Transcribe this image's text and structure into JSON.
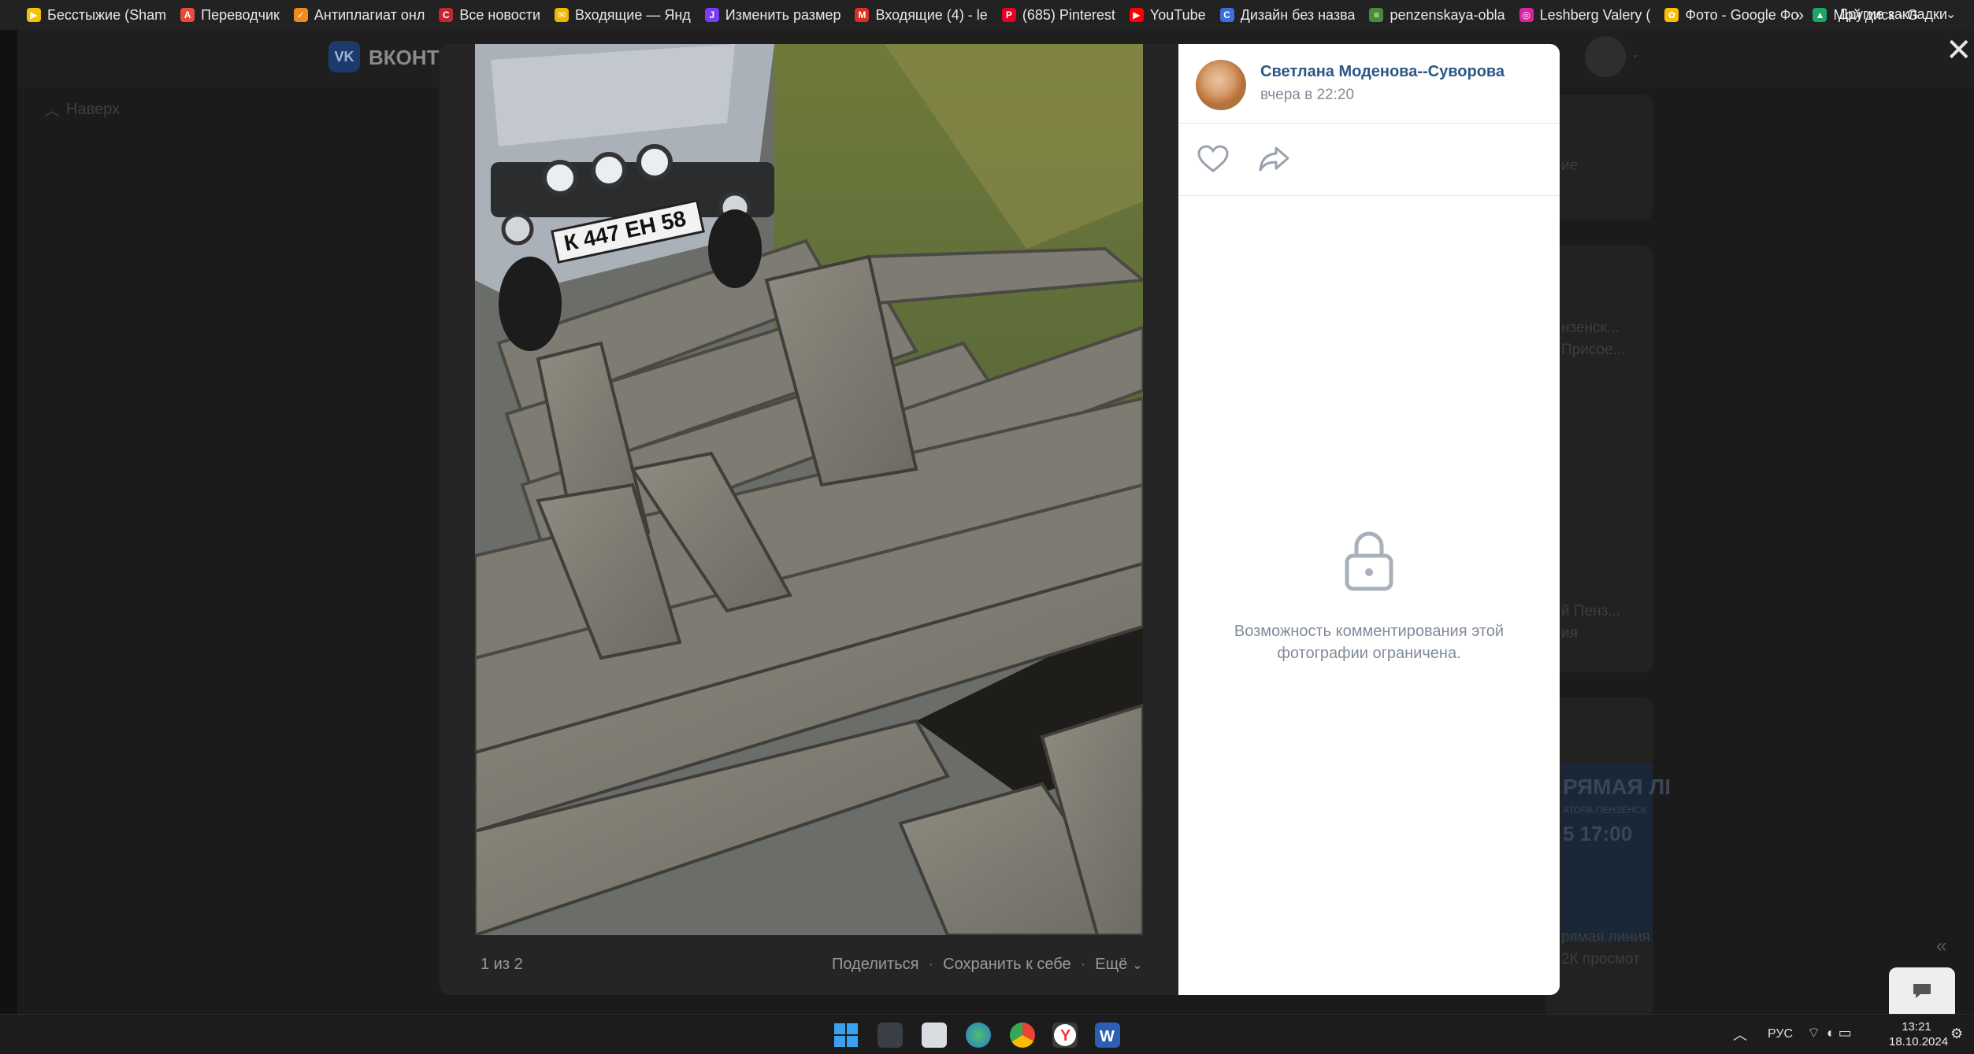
{
  "bookmarks": [
    {
      "label": "Бесстыжие (Sham",
      "color": "#f5c400",
      "glyph": "▶"
    },
    {
      "label": "Переводчик",
      "color": "#e84b3c",
      "glyph": "A"
    },
    {
      "label": "Антиплагиат онл",
      "color": "#f08a1c",
      "glyph": "✓"
    },
    {
      "label": "Все новости",
      "color": "#c4262e",
      "glyph": "C"
    },
    {
      "label": "Входящие — Янд",
      "color": "#f2b600",
      "glyph": "✉"
    },
    {
      "label": "Изменить размер",
      "color": "#7a3cf0",
      "glyph": "J"
    },
    {
      "label": "Входящие (4) - le",
      "color": "#d93025",
      "glyph": "M"
    },
    {
      "label": "(685) Pinterest",
      "color": "#e60023",
      "glyph": "P"
    },
    {
      "label": "YouTube",
      "color": "#ff0000",
      "glyph": "▶"
    },
    {
      "label": "Дизайн без назва",
      "color": "#3b6fe0",
      "glyph": "C"
    },
    {
      "label": "penzenskaya-obla",
      "color": "#4a8a3a",
      "glyph": "≡"
    },
    {
      "label": "Leshberg Valery (",
      "color": "#d6249f",
      "glyph": "◎"
    },
    {
      "label": "Фото - Google Фо",
      "color": "#fbbc04",
      "glyph": "✿"
    },
    {
      "label": "Мой диск - G",
      "color": "#1fa463",
      "glyph": "▲"
    }
  ],
  "bookmarks_more": "»",
  "other_bookmarks": "Другие закладки",
  "vk": {
    "logo_text": "VK",
    "site_name": "ВКОНТ",
    "nav_up": "Наверх",
    "right_fragments": {
      "t1": "ие",
      "t2": "нзенск...",
      "t3": "Присое...",
      "t4": "й Пенз...",
      "t5": "ия",
      "promo_title": "РЯМАЯ ЛІ",
      "promo_sub": "АТОРА ПЕНЗЕНСК",
      "promo_time": "5  17:00",
      "t6": "рямая линия",
      "t7": "2К просмот"
    }
  },
  "viewer": {
    "counter": "1 из 2",
    "share": "Поделиться",
    "save": "Сохранить к себе",
    "more": "Ещё",
    "plate": "К 447 ЕН 58"
  },
  "post": {
    "author": "Светлана Моденова--Суворова",
    "time": "вчера в 22:20",
    "restricted": "Возможность комментирования этой фотографии ограничена."
  },
  "taskbar": {
    "lang": "РУС",
    "time": "13:21",
    "date": "18.10.2024"
  },
  "colors": {
    "link": "#2a5885",
    "muted": "#818c99"
  }
}
